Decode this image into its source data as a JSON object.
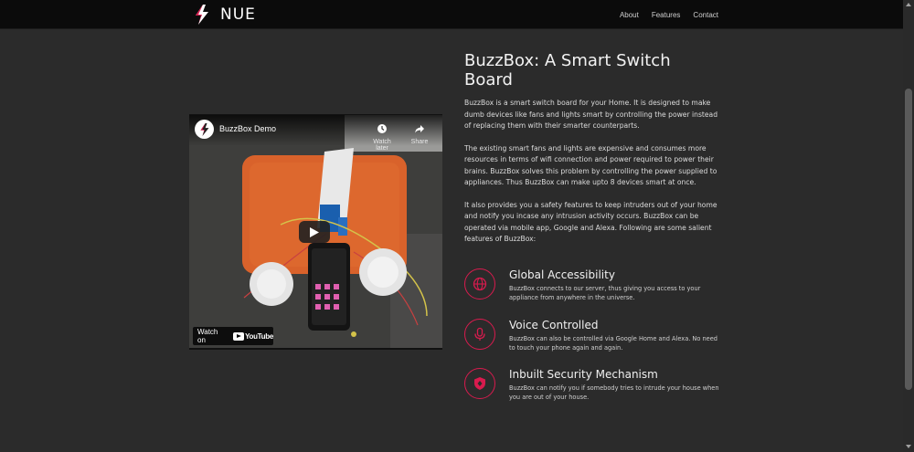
{
  "colors": {
    "accent": "#d81b4e",
    "background": "#2b2b2b",
    "navbar": "#0b0b0b"
  },
  "navbar": {
    "brand": "NUE",
    "links": [
      "About",
      "Features",
      "Contact"
    ]
  },
  "video": {
    "title": "BuzzBox Demo",
    "watch_later": "Watch later",
    "share": "Share",
    "watch_on": "Watch on",
    "youtube": "YouTube"
  },
  "main": {
    "title": "BuzzBox: A Smart Switch Board",
    "paragraphs": [
      "BuzzBox is a smart switch board for your Home. It is designed to make dumb devices like fans and lights smart by controlling the power instead of replacing them with their smarter counterparts.",
      "The existing smart fans and lights are expensive and consumes more resources in terms of wifi connection and power required to power their brains. BuzzBox solves this problem by controlling the power supplied to appliances. Thus BuzzBox can make upto 8 devices smart at once.",
      "It also provides you a safety features to keep intruders out of your home and notify you incase any intrusion activity occurs. BuzzBox can be operated via mobile app, Google and Alexa. Following are some salient features of BuzzBox:"
    ],
    "features": [
      {
        "icon": "globe-icon",
        "title": "Global Accessibility",
        "desc": "BuzzBox connects to our server, thus giving you access to your appliance from anywhere in the universe."
      },
      {
        "icon": "microphone-icon",
        "title": "Voice Controlled",
        "desc": "BuzzBox can also be controlled via Google Home and Alexa. No need to touch your phone again and again."
      },
      {
        "icon": "shield-icon",
        "title": "Inbuilt Security Mechanism",
        "desc": "BuzzBox can notify you if somebody tries to intrude your house when you are out of your house."
      }
    ]
  }
}
